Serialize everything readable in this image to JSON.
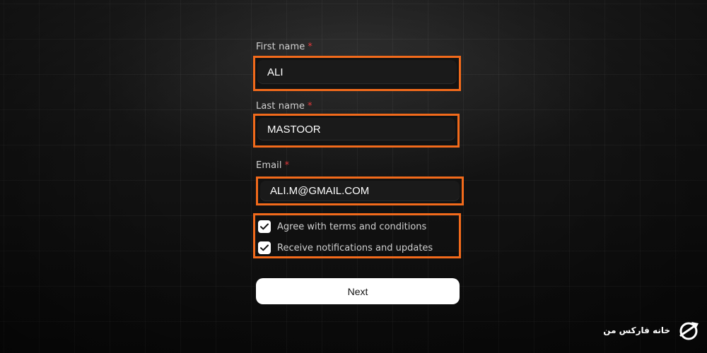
{
  "form": {
    "first_name": {
      "label": "First name",
      "required_mark": "*",
      "value": "ALI"
    },
    "last_name": {
      "label": "Last name",
      "required_mark": "*",
      "value": "MASTOOR"
    },
    "email": {
      "label": "Email",
      "required_mark": "*",
      "value": "ALI.M@GMAIL.COM"
    },
    "checkboxes": [
      {
        "label": "Agree with terms and conditions",
        "checked": true
      },
      {
        "label": "Receive notifications and updates",
        "checked": true
      }
    ],
    "next_label": "Next"
  },
  "highlight_color": "#f26a1b",
  "required_color": "#e5393b",
  "brand": {
    "text": "خانه فارکس من",
    "icon": "globe-arrow-logo-icon"
  }
}
